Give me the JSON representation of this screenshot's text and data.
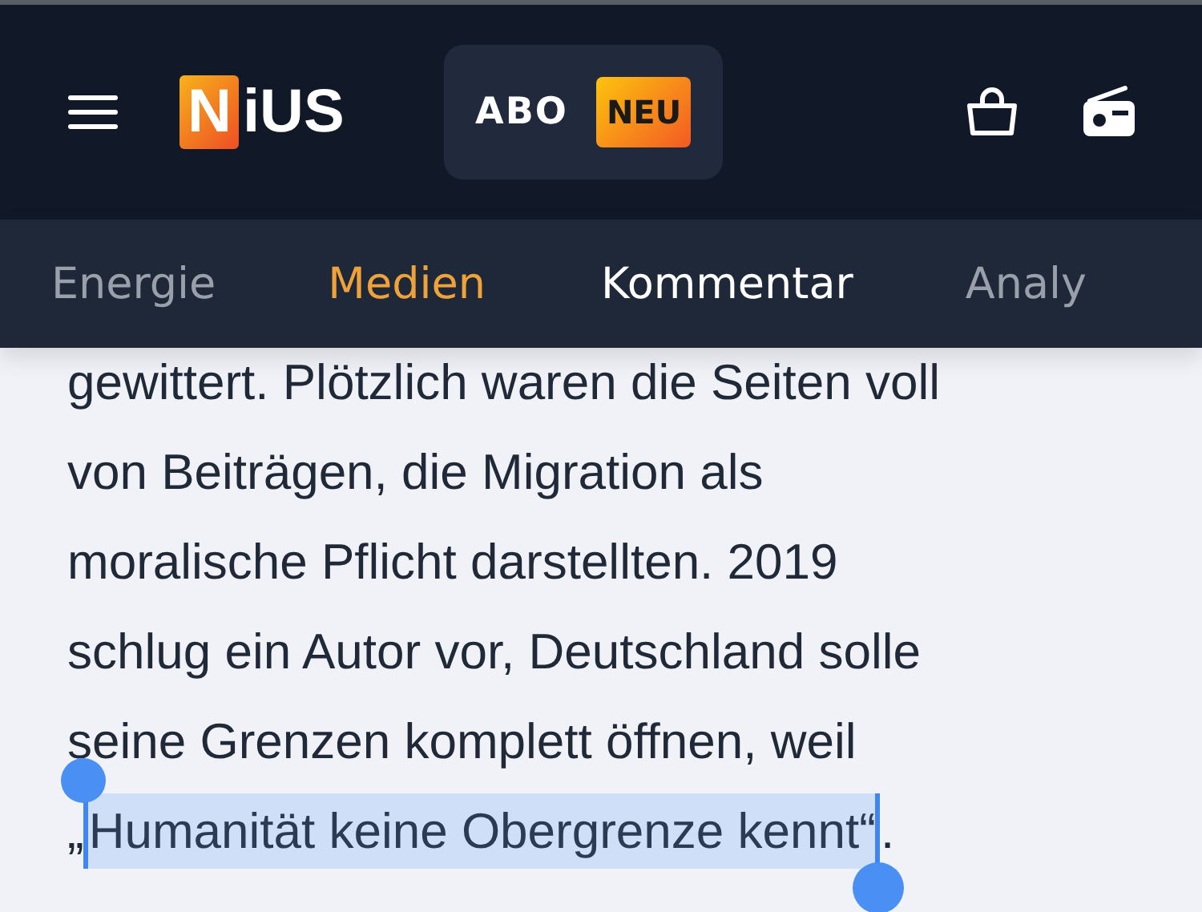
{
  "header": {
    "logo": {
      "boxed": "N",
      "rest": "iUS"
    },
    "abo_button": {
      "label": "ABO",
      "badge": "NEU"
    }
  },
  "nav": {
    "items": [
      {
        "label": "Energie",
        "selected": false,
        "faded": true
      },
      {
        "label": "Medien",
        "selected": true,
        "faded": false
      },
      {
        "label": "Kommentar",
        "selected": false,
        "faded": false
      },
      {
        "label": "Analy",
        "selected": false,
        "faded": true
      }
    ]
  },
  "article": {
    "lines": [
      "gewittert. Plötzlich waren die Seiten voll",
      "von Beiträgen, die Migration als",
      "moralische Pflicht darstellten. 2019",
      "schlug ein Autor vor, Deutschland solle",
      "seine Grenzen komplett öffnen, weil"
    ],
    "before_selection": "„",
    "selection": "Humanität keine Obergrenze kennt“",
    "after_selection": "."
  }
}
